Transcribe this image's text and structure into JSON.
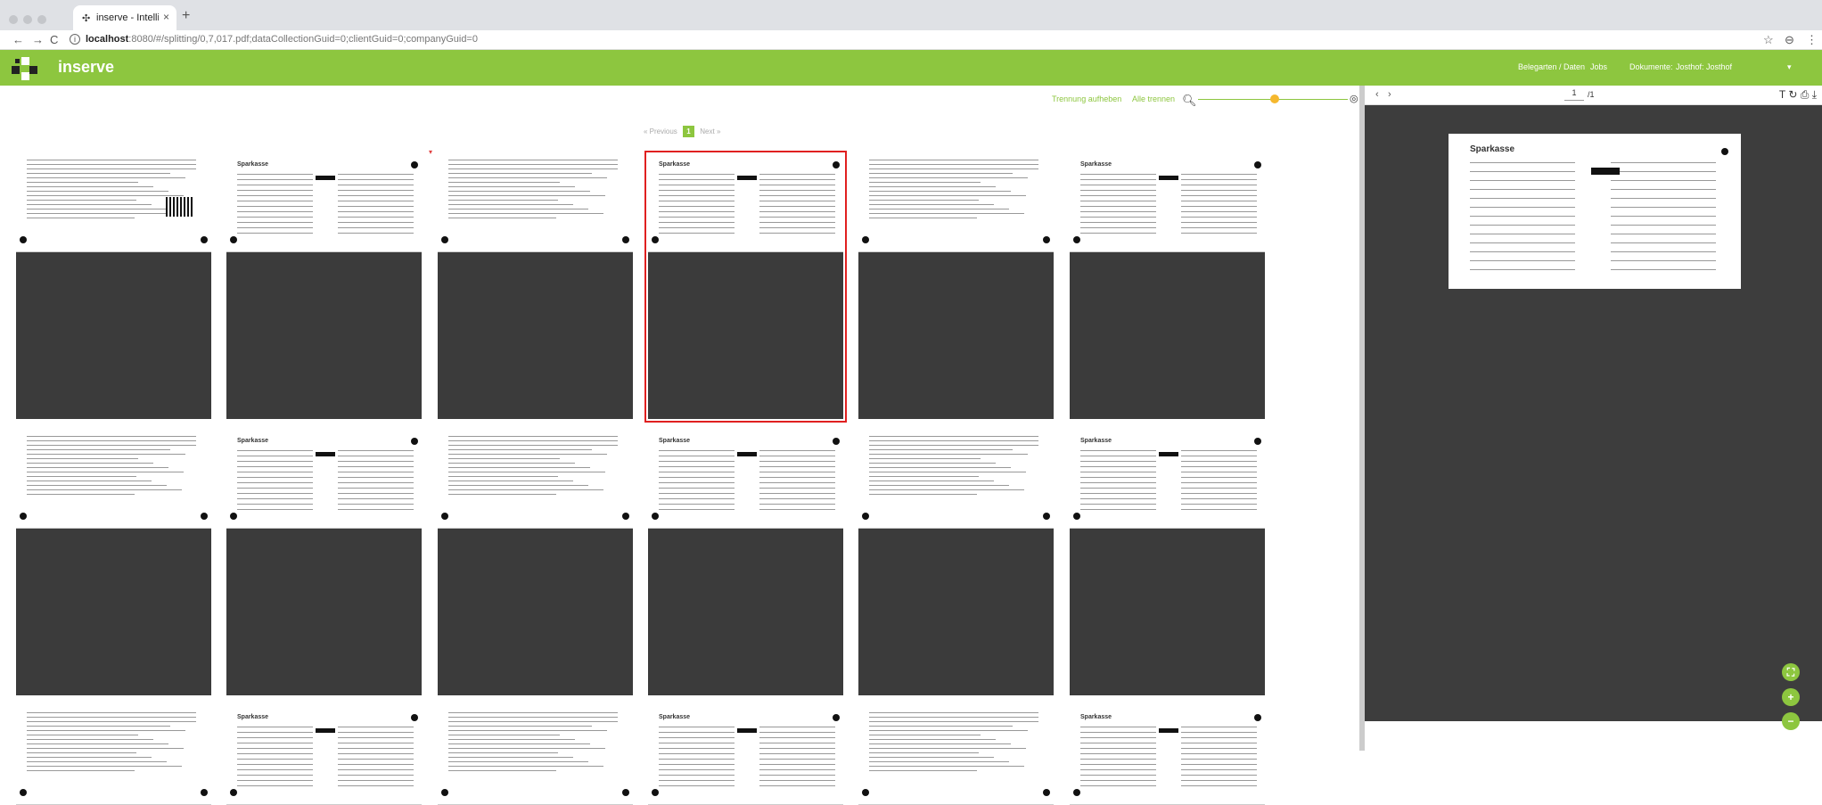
{
  "browser": {
    "tab_title": "inserve - Intelligent Document",
    "tab_close": "×",
    "new_tab": "+",
    "url_host": "localhost",
    "url_rest": ":8080/#/splitting/0,7,017.pdf;dataCollectionGuid=0;clientGuid=0;companyGuid=0",
    "back": "←",
    "forward": "→",
    "reload": "C",
    "star": "☆",
    "profile": "⊖",
    "menu": "⋮"
  },
  "app": {
    "brand": "inserve",
    "nav": {
      "belegarten": "Belegarten / Daten",
      "jobs": "Jobs",
      "dokumente_label": "Dokumente:",
      "dokumente_value": "Josthof: Josthof",
      "dropdown": "▾"
    },
    "colors": {
      "accent": "#8dc63f",
      "selection": "#e02020",
      "slider_thumb": "#f5b82e",
      "viewer_bg": "#3d3d3d"
    }
  },
  "toolbar": {
    "trennung_aufheben": "Trennung aufheben",
    "alle_trennen": "Alle trennen",
    "zoom_icon": "search-icon",
    "zoom_level": 0.5
  },
  "pager": {
    "previous": "« Previous",
    "page": "1",
    "next": "Next »"
  },
  "thumbnails": {
    "rows": 3,
    "columns": 6,
    "selected_index": 3,
    "sparkasse_label": "Sparkasse"
  },
  "viewer": {
    "prev": "‹",
    "next": "›",
    "current_page": "1",
    "total_pages": "/1",
    "tools": "T ↻ ⎙ ⤓",
    "page_heading": "Sparkasse"
  },
  "fabs": {
    "fit": "⛶",
    "zoom_in": "+",
    "zoom_out": "−"
  }
}
